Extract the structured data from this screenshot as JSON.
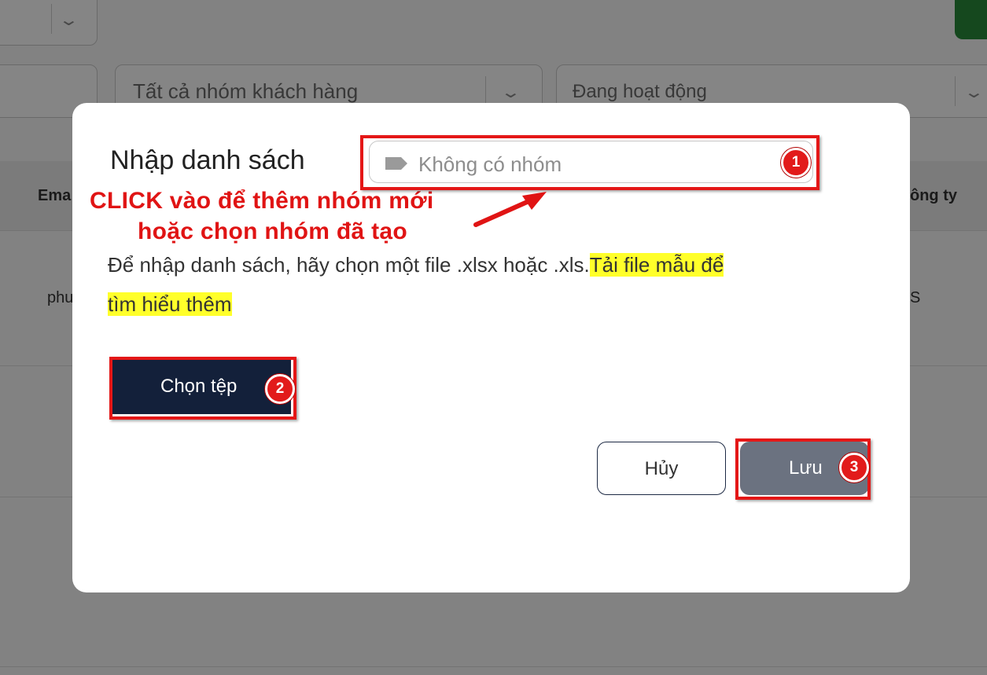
{
  "background": {
    "filters": {
      "customer_group": "Tất cả nhóm khách hàng",
      "status": "Đang hoạt động"
    },
    "table": {
      "header_email": "Ema",
      "header_company": "ông ty",
      "row_cell_left": "phu",
      "row_cell_right": "S"
    }
  },
  "modal": {
    "title": "Nhập danh sách",
    "group_input": {
      "placeholder": "Không có nhóm",
      "icon": "tag-icon"
    },
    "annotation": {
      "line1": "CLICK  vào để thêm nhóm mới",
      "line2": "hoặc chọn nhóm đã tạo"
    },
    "description": {
      "text": "Để nhập danh sách, hãy chọn một file .xlsx hoặc .xls.",
      "link_part1": "Tải file mẫu để",
      "link_part2": "tìm hiểu thêm"
    },
    "choose_file_label": "Chọn tệp",
    "cancel_label": "Hủy",
    "save_label": "Lưu",
    "steps": [
      "1",
      "2",
      "3"
    ]
  },
  "colors": {
    "annotation_red": "#e01414",
    "highlight_yellow": "#ffff2a",
    "choose_button_bg": "#13203a",
    "save_button_bg": "#6b7280"
  }
}
